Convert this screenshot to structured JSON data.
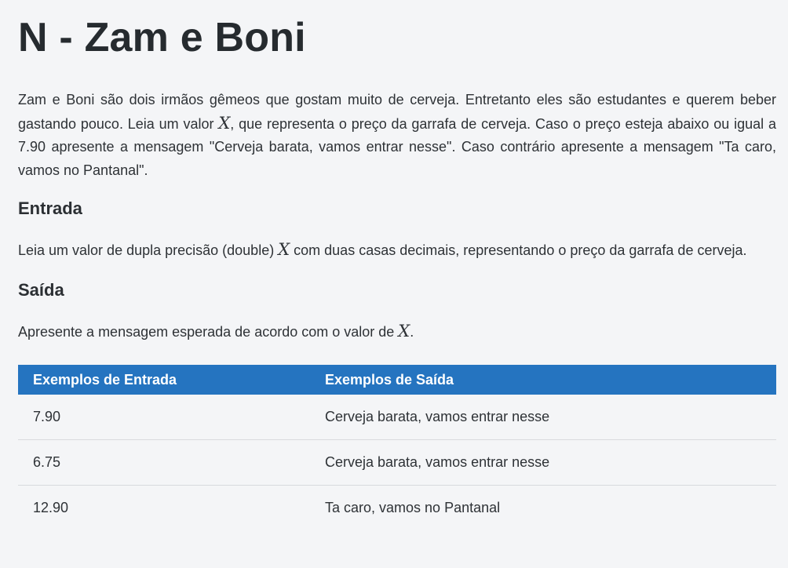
{
  "title": "N - Zam e Boni",
  "intro": {
    "part1": "Zam e Boni são dois irmãos gêmeos que gostam muito de cerveja. Entretanto eles são estudantes e querem beber gastando pouco. Leia um valor ",
    "var": "X",
    "part2": ", que representa o preço da garrafa de cerveja. Caso o preço esteja abaixo ou igual a 7.90 apresente a mensagem \"Cerveja barata, vamos entrar nesse\". Caso contrário apresente a mensagem \"Ta caro, vamos no Pantanal\"."
  },
  "entrada": {
    "heading": "Entrada",
    "part1": "Leia um valor de dupla precisão (double) ",
    "var": "X",
    "part2": " com duas casas decimais, representando o preço da garrafa de cerveja."
  },
  "saida": {
    "heading": "Saída",
    "part1": "Apresente a mensagem esperada de acordo com o valor de ",
    "var": "X",
    "part2": "."
  },
  "examples": {
    "header_input": "Exemplos de Entrada",
    "header_output": "Exemplos de Saída",
    "rows": [
      {
        "input": "7.90",
        "output": "Cerveja barata, vamos entrar nesse"
      },
      {
        "input": "6.75",
        "output": "Cerveja barata, vamos entrar nesse"
      },
      {
        "input": "12.90",
        "output": "Ta caro, vamos no Pantanal"
      }
    ]
  },
  "colors": {
    "table_header": "#2574c0",
    "background": "#f4f5f7",
    "text": "#2b2f33"
  }
}
